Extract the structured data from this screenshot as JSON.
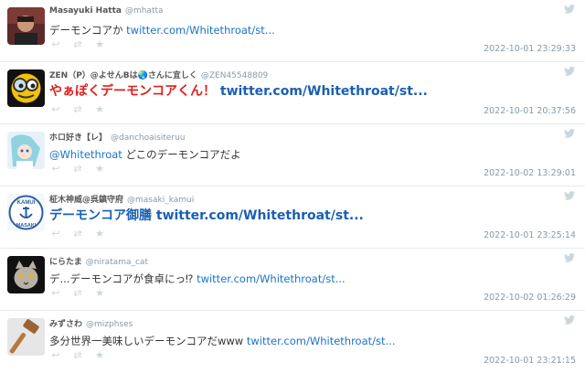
{
  "tweets": [
    {
      "name": "Masayuki Hatta",
      "handle": "@mhatta",
      "text_before": "デーモンコアか ",
      "link": "twitter.com/Whitethroat/st...",
      "text_after": "",
      "time": "2022-10-01 23:29:33",
      "avatar": "person-photo"
    },
    {
      "name": "ZEN（P）@よせんBは🌏さんに宜しく",
      "handle": "@ZEN45548809",
      "text_before": "やぁぽくデーモンコアくん！ ",
      "link": "twitter.com/Whitethroat/st...",
      "text_after": "",
      "time": "2022-10-01 20:37:56",
      "avatar": "emoji-face"
    },
    {
      "name": "ホロ好き【レ】",
      "handle": "@danchoaisiteruu",
      "text_before": "",
      "link": "@Whitethroat",
      "text_after": " どこのデーモンコアだよ",
      "time": "2022-10-02 13:29:01",
      "avatar": "anime-character"
    },
    {
      "name": "柾木神威@呉鎮守府",
      "handle": "@masaki_kamui",
      "text_before": "デーモンコア御膳 ",
      "link": "twitter.com/Whitethroat/st...",
      "text_after": "",
      "time": "2022-10-01 23:25:14",
      "avatar": "kamui-masaki-emblem"
    },
    {
      "name": "にらたま",
      "handle": "@niratama_cat",
      "text_before": "デ...デーモンコアが食卓にっ⁉ ",
      "link": "twitter.com/Whitethroat/st...",
      "text_after": "",
      "time": "2022-10-02 01:26:29",
      "avatar": "cat-photo"
    },
    {
      "name": "みずさわ",
      "handle": "@mizphses",
      "text_before": "多分世界一美味しいデーモンコアだwww ",
      "link": "twitter.com/Whitethroat/st...",
      "text_after": "",
      "time": "2022-10-01 23:21:15",
      "avatar": "hammer-icon"
    }
  ],
  "avatar_labels": {
    "tweet4_top": "KAMUI",
    "tweet4_bottom": "MASAKI"
  },
  "colors": {
    "link": "#1a73c7",
    "red_text": "#e0201e",
    "muted": "#8899a6",
    "divider": "#e6ecf0"
  }
}
